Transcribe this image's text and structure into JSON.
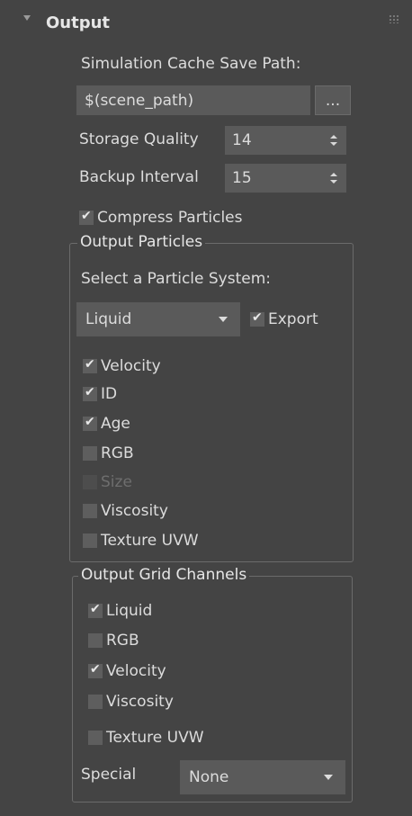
{
  "header": {
    "title": "Output"
  },
  "cache": {
    "path_label": "Simulation Cache Save Path:",
    "path_value": "$(scene_path)",
    "browse_label": "...",
    "storage_label": "Storage Quality",
    "storage_value": "14",
    "backup_label": "Backup Interval",
    "backup_value": "15",
    "compress_label": "Compress Particles",
    "compress_checked": true
  },
  "output_particles": {
    "title": "Output Particles",
    "select_label": "Select a Particle System:",
    "system_value": "Liquid",
    "export_label": "Export",
    "export_checked": true,
    "channels": [
      {
        "label": "Velocity",
        "checked": true,
        "enabled": true
      },
      {
        "label": "ID",
        "checked": true,
        "enabled": true
      },
      {
        "label": "Age",
        "checked": true,
        "enabled": true
      },
      {
        "label": "RGB",
        "checked": false,
        "enabled": true
      },
      {
        "label": "Size",
        "checked": false,
        "enabled": false
      },
      {
        "label": "Viscosity",
        "checked": false,
        "enabled": true
      },
      {
        "label": "Texture UVW",
        "checked": false,
        "enabled": true
      }
    ]
  },
  "output_grid": {
    "title": "Output Grid Channels",
    "channels": [
      {
        "label": "Liquid",
        "checked": true
      },
      {
        "label": "RGB",
        "checked": false
      },
      {
        "label": "Velocity",
        "checked": true
      },
      {
        "label": "Viscosity",
        "checked": false
      },
      {
        "label": "Texture UVW",
        "checked": false
      }
    ],
    "special_label": "Special",
    "special_value": "None"
  },
  "icons": {
    "collapse": "triangle-down-icon",
    "grip": "drag-grip-icon",
    "checkmark": "check-icon",
    "spinner": "spinner-arrows-icon",
    "dropdown": "chevron-down-icon"
  }
}
